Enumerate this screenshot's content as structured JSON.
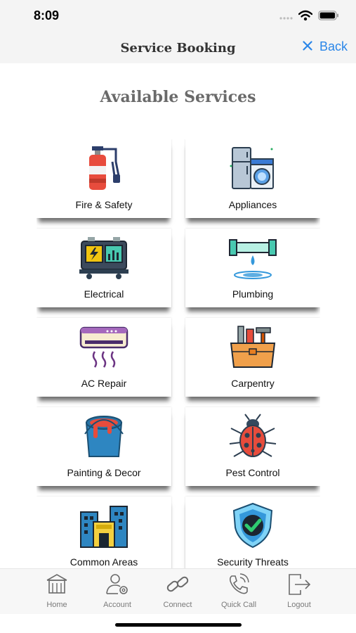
{
  "status_bar": {
    "time": "8:09"
  },
  "header": {
    "title": "Service Booking",
    "back_label": "Back"
  },
  "section_title": "Available Services",
  "services": [
    {
      "label": "Fire & Safety",
      "icon": "fire-extinguisher-icon"
    },
    {
      "label": "Appliances",
      "icon": "appliances-icon"
    },
    {
      "label": "Electrical",
      "icon": "electrical-panel-icon"
    },
    {
      "label": "Plumbing",
      "icon": "pipe-icon"
    },
    {
      "label": "AC Repair",
      "icon": "air-conditioner-icon"
    },
    {
      "label": "Carpentry",
      "icon": "toolbox-icon"
    },
    {
      "label": "Painting & Decor",
      "icon": "paint-bucket-icon"
    },
    {
      "label": "Pest Control",
      "icon": "ladybug-icon"
    },
    {
      "label": "Common Areas",
      "icon": "buildings-icon"
    },
    {
      "label": "Security Threats",
      "icon": "shield-check-icon"
    }
  ],
  "tabs": [
    {
      "label": "Home",
      "icon": "home-icon"
    },
    {
      "label": "Account",
      "icon": "account-settings-icon"
    },
    {
      "label": "Connect",
      "icon": "link-icon"
    },
    {
      "label": "Quick Call",
      "icon": "phone-call-icon"
    },
    {
      "label": "Logout",
      "icon": "logout-icon"
    }
  ],
  "colors": {
    "accent": "#2a86e8",
    "title_gray": "#6a6a6a"
  }
}
